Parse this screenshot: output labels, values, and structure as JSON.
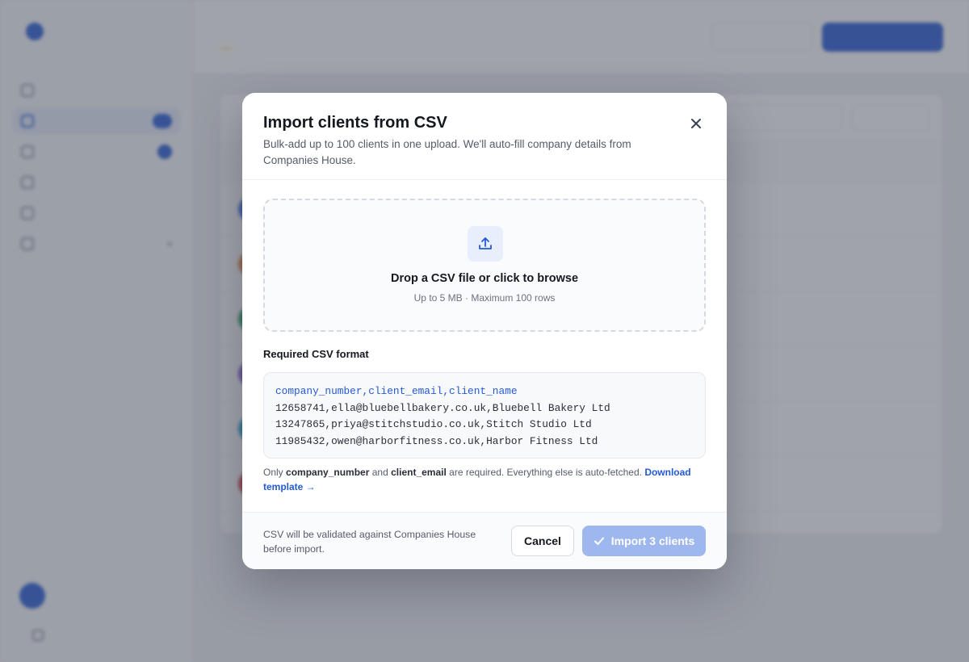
{
  "modal": {
    "title": "Import clients from CSV",
    "description": "Bulk-add up to 100 clients in one upload. We'll auto-fill company details from Companies House.",
    "close_icon": "close-icon",
    "dropzone": {
      "icon": "upload-icon",
      "title": "Drop a CSV file or click to browse",
      "hint": "Up to 5 MB · Maximum 100 rows"
    },
    "format_label": "Required CSV format",
    "csv_header": "company_number,client_email,client_name",
    "csv_rows": [
      "12658741,ella@bluebellbakery.co.uk,Bluebell Bakery Ltd",
      "13247865,priya@stitchstudio.co.uk,Stitch Studio Ltd",
      "11985432,owen@harborfitness.co.uk,Harbor Fitness Ltd"
    ],
    "note": {
      "prefix": "Only",
      "field1": "company_number",
      "and": "and",
      "field2": "client_email",
      "suffix": "are required. Everything else is auto-fetched.",
      "link": "Download template →"
    },
    "footer": {
      "text": "CSV will be validated against Companies House before import.",
      "cancel_label": "Cancel",
      "import_label": "Import 3 clients",
      "import_icon": "check-icon"
    }
  },
  "colors": {
    "accent": "#2459d6",
    "accent_disabled": "#9eb7ee",
    "scrim": "#484e5c"
  }
}
